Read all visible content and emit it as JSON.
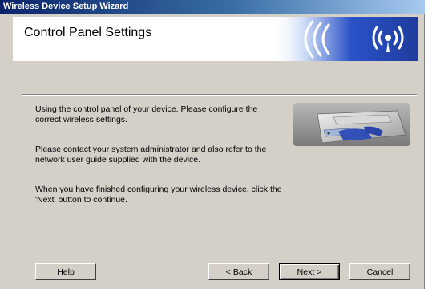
{
  "window": {
    "title": "Wireless Device Setup Wizard"
  },
  "header": {
    "page_title": "Control Panel Settings",
    "banner_icon": "wireless-signal-icon",
    "colors": {
      "banner_dark": "#1e3c9c",
      "banner_light": "#7fa6e8"
    }
  },
  "body": {
    "paragraphs": [
      "Using the control panel of your device. Please configure the correct wireless settings.",
      "Please contact your system administrator and also refer to the network user guide supplied with the device.",
      "When you have finished configuring your wireless device, click the 'Next' button to continue."
    ],
    "illustration": "printer-control-panel-image"
  },
  "buttons": {
    "help": "Help",
    "back": "< Back",
    "next": "Next >",
    "cancel": "Cancel"
  }
}
